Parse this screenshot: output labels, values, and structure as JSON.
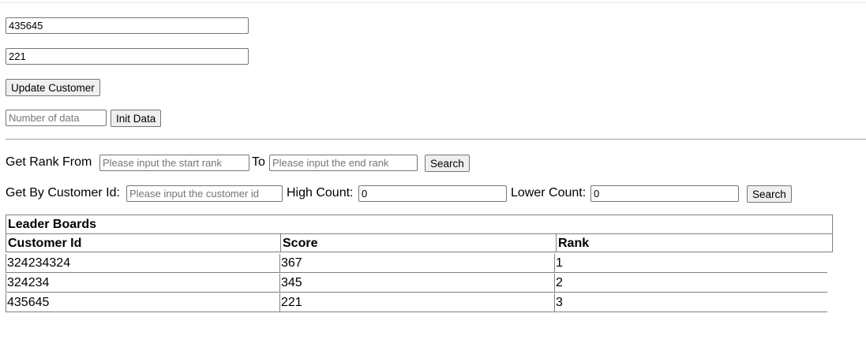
{
  "customer_form": {
    "customer_id_value": "435645",
    "score_value": "221",
    "update_button_label": "Update Customer"
  },
  "init_form": {
    "count_placeholder": "Number of data",
    "init_button_label": "Init Data"
  },
  "rank_search": {
    "from_label": "Get Rank From",
    "start_placeholder": "Please input the start rank",
    "to_label": "To",
    "end_placeholder": "Please input the end rank",
    "search_button_label": "Search"
  },
  "customer_search": {
    "customer_label": "Get By Customer Id:",
    "customer_placeholder": "Please input the customer id",
    "high_label": "High Count:",
    "high_value": "0",
    "lower_label": "Lower Count:",
    "lower_value": "0",
    "search_button_label": "Search"
  },
  "leaderboard": {
    "title": "Leader Boards",
    "columns": [
      "Customer Id",
      "Score",
      "Rank"
    ],
    "rows": [
      [
        "324234324",
        "367",
        "1"
      ],
      [
        "324234",
        "345",
        "2"
      ],
      [
        "435645",
        "221",
        "3"
      ]
    ]
  }
}
